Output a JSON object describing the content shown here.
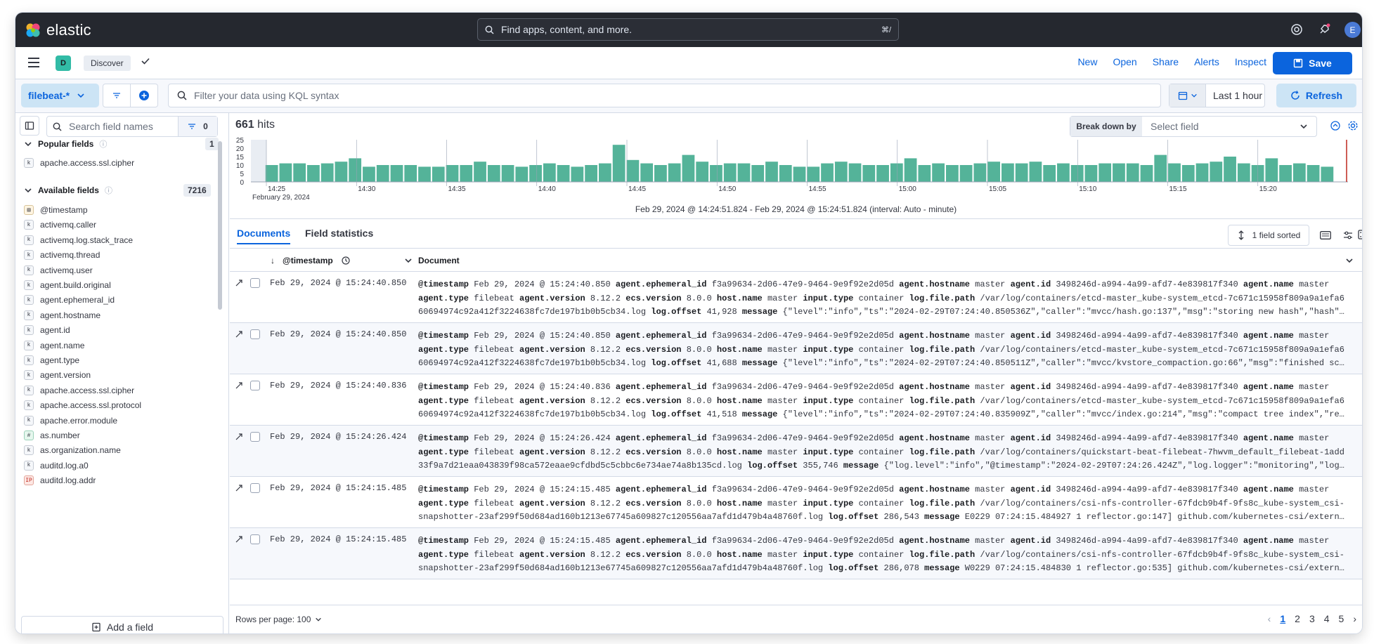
{
  "header": {
    "logo_text": "elastic",
    "search_placeholder": "Find apps, content, and more.",
    "search_shortcut": "⌘/",
    "avatar_initial": "E"
  },
  "appbar": {
    "space_initial": "D",
    "breadcrumb": "Discover",
    "links": [
      "New",
      "Open",
      "Share",
      "Alerts",
      "Inspect"
    ],
    "save_label": "Save"
  },
  "querybar": {
    "data_view": "filebeat-*",
    "kql_placeholder": "Filter your data using KQL syntax",
    "time_range": "Last 1 hour",
    "refresh_label": "Refresh"
  },
  "sidebar": {
    "search_placeholder": "Search field names",
    "filter_count": "0",
    "popular_title": "Popular fields",
    "popular_count": "1",
    "popular_fields": [
      {
        "name": "apache.access.ssl.cipher",
        "type": "k"
      }
    ],
    "available_title": "Available fields",
    "available_count": "7216",
    "available_fields": [
      {
        "name": "@timestamp",
        "type": "date"
      },
      {
        "name": "activemq.caller",
        "type": "k"
      },
      {
        "name": "activemq.log.stack_trace",
        "type": "k"
      },
      {
        "name": "activemq.thread",
        "type": "k"
      },
      {
        "name": "activemq.user",
        "type": "k"
      },
      {
        "name": "agent.build.original",
        "type": "k"
      },
      {
        "name": "agent.ephemeral_id",
        "type": "k"
      },
      {
        "name": "agent.hostname",
        "type": "k"
      },
      {
        "name": "agent.id",
        "type": "k"
      },
      {
        "name": "agent.name",
        "type": "k"
      },
      {
        "name": "agent.type",
        "type": "k"
      },
      {
        "name": "agent.version",
        "type": "k"
      },
      {
        "name": "apache.access.ssl.cipher",
        "type": "k"
      },
      {
        "name": "apache.access.ssl.protocol",
        "type": "k"
      },
      {
        "name": "apache.error.module",
        "type": "k"
      },
      {
        "name": "as.number",
        "type": "#"
      },
      {
        "name": "as.organization.name",
        "type": "k"
      },
      {
        "name": "auditd.log.a0",
        "type": "k"
      },
      {
        "name": "auditd.log.addr",
        "type": "ip"
      }
    ],
    "add_field_label": "Add a field"
  },
  "main": {
    "hits_count": "661",
    "hits_label": "hits",
    "breakdown_label": "Break down by",
    "breakdown_placeholder": "Select field",
    "interval_text": "Feb 29, 2024 @ 14:24:51.824 - Feb 29, 2024 @ 15:24:51.824 (interval: Auto - minute)",
    "tabs": [
      "Documents",
      "Field statistics"
    ],
    "sorted_label": "1 field sorted",
    "col_timestamp": "@timestamp",
    "col_document": "Document",
    "rows_per_page": "Rows per page: 100",
    "pages": [
      "1",
      "2",
      "3",
      "4",
      "5"
    ],
    "rows": [
      {
        "timestamp": "Feb 29, 2024 @ 15:24:40.850",
        "line1": [
          [
            "@timestamp",
            "Feb 29, 2024 @ 15:24:40.850"
          ],
          [
            "agent.ephemeral_id",
            "f3a99634-2d06-47e9-9464-9e9f92e2d05d"
          ],
          [
            "agent.hostname",
            "master"
          ],
          [
            "agent.id",
            "3498246d-a994-4a99-afd7-4e839817f340"
          ],
          [
            "agent.name",
            "master"
          ]
        ],
        "line2": [
          [
            "agent.type",
            "filebeat"
          ],
          [
            "agent.version",
            "8.12.2"
          ],
          [
            "ecs.version",
            "8.0.0"
          ],
          [
            "host.name",
            "master"
          ],
          [
            "input.type",
            "container"
          ],
          [
            "log.file.path",
            "/var/log/containers/etcd-master_kube-system_etcd-7c671c15958f809a9a1efa6"
          ]
        ],
        "line3": [
          [
            "",
            "60694974c92a412f3224638fc7de197b1b0b5cb34.log"
          ],
          [
            "log.offset",
            "41,928"
          ],
          [
            "message",
            "{\"level\":\"info\",\"ts\":\"2024-02-29T07:24:40.850536Z\",\"caller\":\"mvcc/hash.go:137\",\"msg\":\"storing new hash\",\"hash\"…"
          ]
        ]
      },
      {
        "timestamp": "Feb 29, 2024 @ 15:24:40.850",
        "line1": [
          [
            "@timestamp",
            "Feb 29, 2024 @ 15:24:40.850"
          ],
          [
            "agent.ephemeral_id",
            "f3a99634-2d06-47e9-9464-9e9f92e2d05d"
          ],
          [
            "agent.hostname",
            "master"
          ],
          [
            "agent.id",
            "3498246d-a994-4a99-afd7-4e839817f340"
          ],
          [
            "agent.name",
            "master"
          ]
        ],
        "line2": [
          [
            "agent.type",
            "filebeat"
          ],
          [
            "agent.version",
            "8.12.2"
          ],
          [
            "ecs.version",
            "8.0.0"
          ],
          [
            "host.name",
            "master"
          ],
          [
            "input.type",
            "container"
          ],
          [
            "log.file.path",
            "/var/log/containers/etcd-master_kube-system_etcd-7c671c15958f809a9a1efa6"
          ]
        ],
        "line3": [
          [
            "",
            "60694974c92a412f3224638fc7de197b1b0b5cb34.log"
          ],
          [
            "log.offset",
            "41,688"
          ],
          [
            "message",
            "{\"level\":\"info\",\"ts\":\"2024-02-29T07:24:40.850511Z\",\"caller\":\"mvcc/kvstore_compaction.go:66\",\"msg\":\"finished sc…"
          ]
        ]
      },
      {
        "timestamp": "Feb 29, 2024 @ 15:24:40.836",
        "line1": [
          [
            "@timestamp",
            "Feb 29, 2024 @ 15:24:40.836"
          ],
          [
            "agent.ephemeral_id",
            "f3a99634-2d06-47e9-9464-9e9f92e2d05d"
          ],
          [
            "agent.hostname",
            "master"
          ],
          [
            "agent.id",
            "3498246d-a994-4a99-afd7-4e839817f340"
          ],
          [
            "agent.name",
            "master"
          ]
        ],
        "line2": [
          [
            "agent.type",
            "filebeat"
          ],
          [
            "agent.version",
            "8.12.2"
          ],
          [
            "ecs.version",
            "8.0.0"
          ],
          [
            "host.name",
            "master"
          ],
          [
            "input.type",
            "container"
          ],
          [
            "log.file.path",
            "/var/log/containers/etcd-master_kube-system_etcd-7c671c15958f809a9a1efa6"
          ]
        ],
        "line3": [
          [
            "",
            "60694974c92a412f3224638fc7de197b1b0b5cb34.log"
          ],
          [
            "log.offset",
            "41,518"
          ],
          [
            "message",
            "{\"level\":\"info\",\"ts\":\"2024-02-29T07:24:40.835909Z\",\"caller\":\"mvcc/index.go:214\",\"msg\":\"compact tree index\",\"re…"
          ]
        ]
      },
      {
        "timestamp": "Feb 29, 2024 @ 15:24:26.424",
        "line1": [
          [
            "@timestamp",
            "Feb 29, 2024 @ 15:24:26.424"
          ],
          [
            "agent.ephemeral_id",
            "f3a99634-2d06-47e9-9464-9e9f92e2d05d"
          ],
          [
            "agent.hostname",
            "master"
          ],
          [
            "agent.id",
            "3498246d-a994-4a99-afd7-4e839817f340"
          ],
          [
            "agent.name",
            "master"
          ]
        ],
        "line2": [
          [
            "agent.type",
            "filebeat"
          ],
          [
            "agent.version",
            "8.12.2"
          ],
          [
            "ecs.version",
            "8.0.0"
          ],
          [
            "host.name",
            "master"
          ],
          [
            "input.type",
            "container"
          ],
          [
            "log.file.path",
            "/var/log/containers/quickstart-beat-filebeat-7hwvm_default_filebeat-1add"
          ]
        ],
        "line3": [
          [
            "",
            "33f9a7d21eaa043839f98ca572eaae9cfdbd5c5cbbc6e734ae74a8b135cd.log"
          ],
          [
            "log.offset",
            "355,746"
          ],
          [
            "message",
            "{\"log.level\":\"info\",\"@timestamp\":\"2024-02-29T07:24:26.424Z\",\"log.logger\":\"monitoring\",\"log…"
          ]
        ]
      },
      {
        "timestamp": "Feb 29, 2024 @ 15:24:15.485",
        "line1": [
          [
            "@timestamp",
            "Feb 29, 2024 @ 15:24:15.485"
          ],
          [
            "agent.ephemeral_id",
            "f3a99634-2d06-47e9-9464-9e9f92e2d05d"
          ],
          [
            "agent.hostname",
            "master"
          ],
          [
            "agent.id",
            "3498246d-a994-4a99-afd7-4e839817f340"
          ],
          [
            "agent.name",
            "master"
          ]
        ],
        "line2": [
          [
            "agent.type",
            "filebeat"
          ],
          [
            "agent.version",
            "8.12.2"
          ],
          [
            "ecs.version",
            "8.0.0"
          ],
          [
            "host.name",
            "master"
          ],
          [
            "input.type",
            "container"
          ],
          [
            "log.file.path",
            "/var/log/containers/csi-nfs-controller-67fdcb9b4f-9fs8c_kube-system_csi-"
          ]
        ],
        "line3": [
          [
            "",
            "snapshotter-23af299f50d684ad160b1213e67745a609827c120556aa7afd1d479b4a48760f.log"
          ],
          [
            "log.offset",
            "286,543"
          ],
          [
            "message",
            "E0229 07:24:15.484927 1 reflector.go:147] github.com/kubernetes-csi/extern…"
          ]
        ]
      },
      {
        "timestamp": "Feb 29, 2024 @ 15:24:15.485",
        "line1": [
          [
            "@timestamp",
            "Feb 29, 2024 @ 15:24:15.485"
          ],
          [
            "agent.ephemeral_id",
            "f3a99634-2d06-47e9-9464-9e9f92e2d05d"
          ],
          [
            "agent.hostname",
            "master"
          ],
          [
            "agent.id",
            "3498246d-a994-4a99-afd7-4e839817f340"
          ],
          [
            "agent.name",
            "master"
          ]
        ],
        "line2": [
          [
            "agent.type",
            "filebeat"
          ],
          [
            "agent.version",
            "8.12.2"
          ],
          [
            "ecs.version",
            "8.0.0"
          ],
          [
            "host.name",
            "master"
          ],
          [
            "input.type",
            "container"
          ],
          [
            "log.file.path",
            "/var/log/containers/csi-nfs-controller-67fdcb9b4f-9fs8c_kube-system_csi-"
          ]
        ],
        "line3": [
          [
            "",
            "snapshotter-23af299f50d684ad160b1213e67745a609827c120556aa7afd1d479b4a48760f.log"
          ],
          [
            "log.offset",
            "286,078"
          ],
          [
            "message",
            "W0229 07:24:15.484830 1 reflector.go:535] github.com/kubernetes-csi/extern…"
          ]
        ]
      }
    ]
  },
  "chart_data": {
    "type": "bar",
    "x_tick_labels": [
      "14:25",
      "14:30",
      "14:35",
      "14:40",
      "14:45",
      "14:50",
      "14:55",
      "15:00",
      "15:05",
      "15:10",
      "15:15",
      "15:20"
    ],
    "x_sublabel": "February 29, 2024",
    "y_ticks": [
      0,
      5,
      10,
      15,
      20,
      25
    ],
    "ylim": [
      0,
      25
    ],
    "values": [
      0,
      10,
      11,
      11,
      10,
      11,
      12,
      14,
      9,
      10,
      10,
      10,
      9,
      9,
      10,
      10,
      12,
      10,
      10,
      9,
      10,
      11,
      10,
      9,
      10,
      11,
      22,
      13,
      11,
      10,
      11,
      16,
      12,
      10,
      11,
      11,
      10,
      12,
      10,
      9,
      9,
      11,
      12,
      11,
      10,
      10,
      11,
      14,
      10,
      11,
      10,
      10,
      11,
      12,
      11,
      11,
      12,
      10,
      11,
      10,
      10,
      11,
      11,
      11,
      10,
      16,
      11,
      10,
      11,
      12,
      15,
      11,
      10,
      14,
      10,
      11,
      10,
      9,
      0
    ],
    "color": "#54b399"
  },
  "colors": {
    "primary": "#0b64dd",
    "header_bg": "#25282f",
    "bar": "#54b399"
  }
}
